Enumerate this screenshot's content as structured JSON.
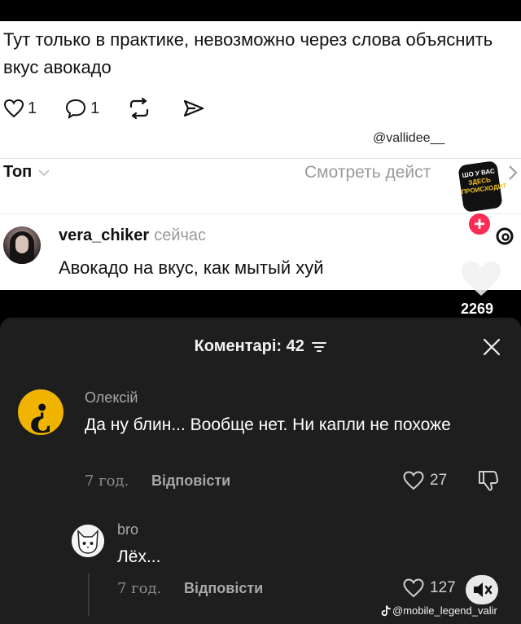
{
  "post": {
    "text": "Тут только в практике, невозможно через слова объяснить вкус авокадо",
    "likes": "1",
    "replies": "1",
    "watermark": "@vallidee__"
  },
  "comments_header": {
    "sort_label": "Топ",
    "view_all_label": "Смотреть дейст"
  },
  "top_comment": {
    "username": "vera_chiker",
    "time": "сейчас",
    "text": "Авокадо на вкус, как мытый хуй"
  },
  "sticker": {
    "line1": "ШО У ВАС",
    "line2": "ЗДЕСЬ",
    "line3": "ПРОИСХОДИТ"
  },
  "tiktok_sidebar": {
    "like_count": "2269"
  },
  "panel": {
    "title": "Коментарі: 42",
    "comments": [
      {
        "name": "Олексій",
        "text": "Да ну блин... Вообще нет. Ни капли не похоже",
        "time": "7 год.",
        "reply_label": "Відповісти",
        "likes": "27"
      },
      {
        "name": "bro",
        "text": "Лёх...",
        "time": "7 год.",
        "reply_label": "Відповісти",
        "likes": "127"
      }
    ],
    "watermark": "@mobile_legend_valir"
  },
  "colors": {
    "panel_bg": "#1e1e1e",
    "accent_red": "#fe2c55",
    "avatar_yellow": "#f0b400"
  }
}
